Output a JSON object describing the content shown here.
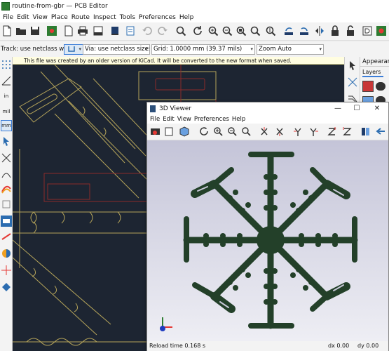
{
  "window": {
    "title": "routine-from-gbr — PCB Editor"
  },
  "menu": [
    "File",
    "Edit",
    "View",
    "Place",
    "Route",
    "Inspect",
    "Tools",
    "Preferences",
    "Help"
  ],
  "toolbar_icons": [
    "new-board-icon",
    "open-icon",
    "save-icon",
    "board-setup-icon",
    "page-setup-icon",
    "print-icon",
    "plot-icon",
    "find-icon",
    "undo-icon",
    "redo-icon",
    "search-icon",
    "refresh-icon",
    "zoom-in-icon",
    "zoom-out-icon",
    "zoom-fit-icon",
    "zoom-objects-icon",
    "zoom-selection-icon",
    "rotate-ccw-icon",
    "rotate-cw-icon",
    "mirror-icon",
    "lock-icon",
    "unlock-icon",
    "netlist-icon"
  ],
  "options_bar": {
    "track_label": "Track: use netclass width",
    "via_label": "Via: use netclass sizes",
    "grid_label": "Grid: 1.0000 mm (39.37 mils)",
    "zoom_label": "Zoom Auto"
  },
  "banner": {
    "text": "This file was created by an older version of KiCad. It will be converted to the new format when saved."
  },
  "left_toolbar": {
    "items": [
      {
        "icon": "grid-icon"
      },
      {
        "icon": "polar-coords-icon"
      },
      {
        "label": "in"
      },
      {
        "label": "mil"
      },
      {
        "label": "mm"
      },
      {
        "icon": "cursor-icon"
      },
      {
        "icon": "ratsnest-icon"
      },
      {
        "icon": "curved-ratsnest-icon"
      },
      {
        "icon": "zone-outline-icon"
      },
      {
        "icon": "pad-outline-icon"
      },
      {
        "icon": "via-outline-icon"
      },
      {
        "icon": "track-outline-icon"
      },
      {
        "icon": "high-contrast-icon"
      },
      {
        "icon": "layers-manager-icon"
      }
    ]
  },
  "appearance_panel": {
    "title": "Appearance",
    "tab": "Layers",
    "layer_colors": [
      "#c83737",
      "#6aa0e0",
      "#cccccc"
    ]
  },
  "viewer": {
    "title": "3D Viewer",
    "menu": [
      "File",
      "Edit",
      "View",
      "Preferences",
      "Help"
    ],
    "status": {
      "reload": "Reload time 0.168 s",
      "dx": "dx 0.00",
      "dy": "dy 0.00"
    },
    "board_color": "#234029",
    "background_top": "#c4c4d8",
    "background_bottom": "#eeeef4"
  },
  "colors": {
    "canvas_bg": "#1d2532",
    "outline": "#b5a45a",
    "fab": "#8a2a2a"
  }
}
